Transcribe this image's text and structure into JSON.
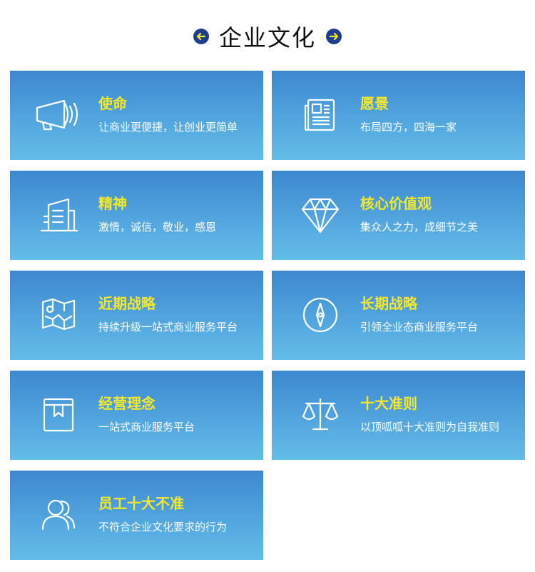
{
  "header": {
    "title": "企业文化",
    "left_icon": "arrow-left-icon",
    "right_icon": "arrow-right-icon"
  },
  "colors": {
    "accent_yellow": "#f5e72c",
    "card_top": "#3d88d1",
    "card_bottom": "#63bde8",
    "arrow_bg": "#1f3f8c"
  },
  "cards": [
    {
      "title": "使命",
      "desc": "让商业更便捷，让创业更简单",
      "icon": "megaphone-icon"
    },
    {
      "title": "愿景",
      "desc": "布局四方，四海一家",
      "icon": "newspaper-icon"
    },
    {
      "title": "精神",
      "desc": "激情，诚信，敬业，感恩",
      "icon": "building-icon"
    },
    {
      "title": "核心价值观",
      "desc": "集众人之力，成细节之美",
      "icon": "diamond-icon"
    },
    {
      "title": "近期战略",
      "desc": "持续升级一站式商业服务平台",
      "icon": "map-icon"
    },
    {
      "title": "长期战略",
      "desc": "引领全业态商业服务平台",
      "icon": "compass-icon"
    },
    {
      "title": "经营理念",
      "desc": "一站式商业服务平台",
      "icon": "bookmark-book-icon"
    },
    {
      "title": "十大准则",
      "desc": "以顶呱呱十大准则为自我准则",
      "icon": "scales-icon"
    },
    {
      "title": "员工十大不准",
      "desc": "不符合企业文化要求的行为",
      "icon": "users-icon"
    }
  ]
}
